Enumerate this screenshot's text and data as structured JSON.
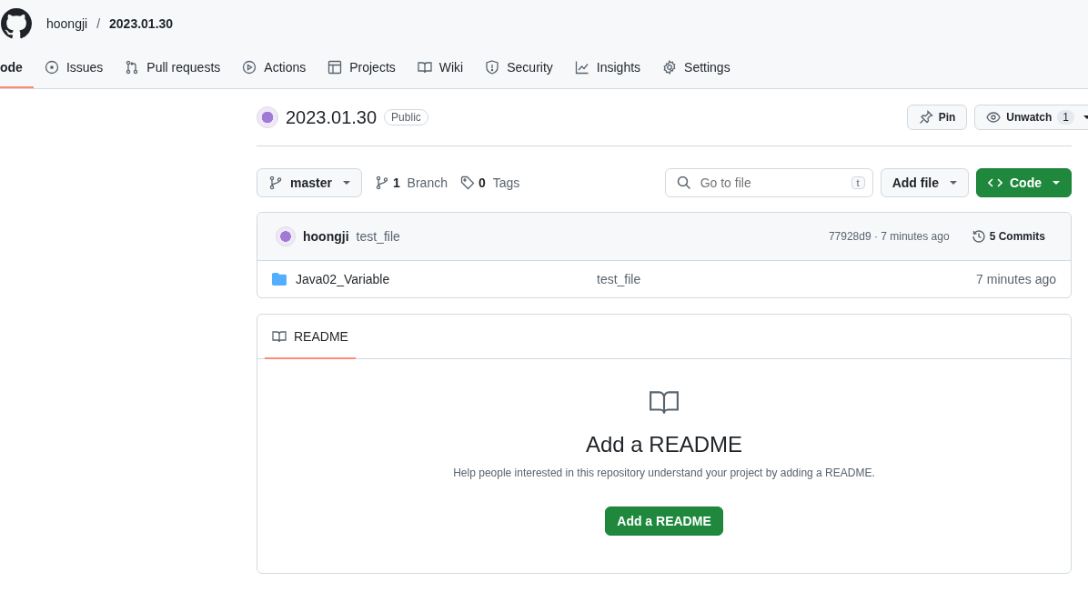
{
  "breadcrumb": {
    "owner": "hoongji",
    "separator": "/",
    "repo": "2023.01.30"
  },
  "tabs": [
    {
      "label": "ode",
      "selected": true
    },
    {
      "label": "Issues",
      "selected": false
    },
    {
      "label": "Pull requests",
      "selected": false
    },
    {
      "label": "Actions",
      "selected": false
    },
    {
      "label": "Projects",
      "selected": false
    },
    {
      "label": "Wiki",
      "selected": false
    },
    {
      "label": "Security",
      "selected": false
    },
    {
      "label": "Insights",
      "selected": false
    },
    {
      "label": "Settings",
      "selected": false
    }
  ],
  "repo": {
    "name": "2023.01.30",
    "visibility": "Public",
    "pin": "Pin",
    "watch": "Unwatch",
    "watch_count": "1"
  },
  "toolbar": {
    "branch": "master",
    "branches": "1",
    "branches_label": "Branch",
    "tags": "0",
    "tags_label": "Tags",
    "search_placeholder": "Go to file",
    "search_key": "t",
    "add_file": "Add file",
    "code": "Code"
  },
  "commit": {
    "author": "hoongji",
    "message": "test_file",
    "sha": "77928d9 · 7 minutes ago",
    "commits": "5 Commits"
  },
  "files": [
    {
      "name": "Java02_Variable",
      "message": "test_file",
      "time": "7 minutes ago"
    }
  ],
  "readme": {
    "tab": "README",
    "title": "Add a README",
    "text": "Help people interested in this repository understand your project by adding a README.",
    "button": "Add a README"
  }
}
